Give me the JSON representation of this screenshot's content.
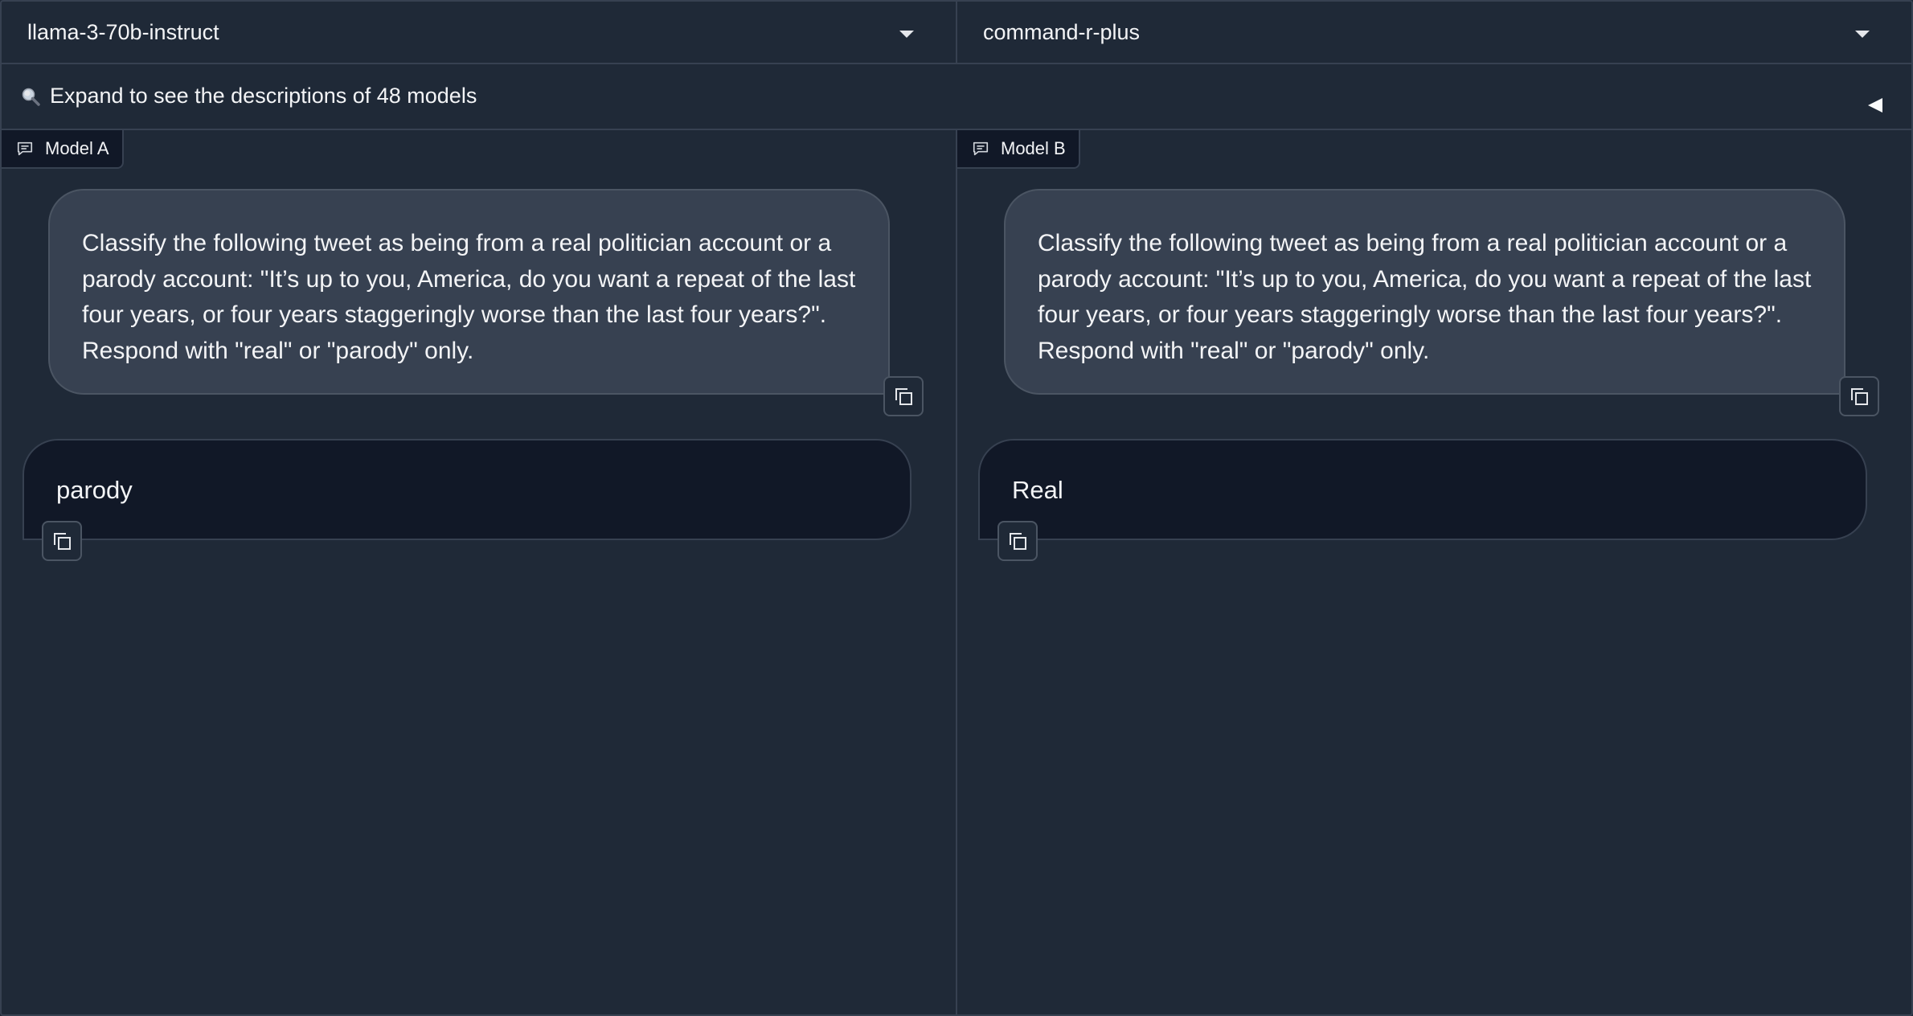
{
  "model_a": {
    "selected": "llama-3-70b-instruct",
    "label": "Model A",
    "user_message": "Classify the following tweet as being from a real politician account or a parody account: \"It’s up to you, America, do you want a repeat of the last four years, or four years staggeringly worse than the last four years?\". Respond with \"real\" or \"parody\" only.",
    "user_lines": [
      "Classify the following tweet as being from a real politician account or a",
      "parody account: \"It’s up to you, America, do you want a repeat of the last",
      "four years, or four years staggeringly worse than the last four years?\".",
      "Respond with \"real\" or \"parody\" only."
    ],
    "response": "parody"
  },
  "model_b": {
    "selected": "command-r-plus",
    "label": "Model B",
    "user_lines": [
      "Classify the following tweet as being from a real politician account or a",
      "parody account: \"It’s up to you, America, do you want a repeat of the last",
      "four years, or four years staggeringly worse than the last four years?\".",
      "Respond with \"real\" or \"parody\" only."
    ],
    "response": "Real"
  },
  "expand": {
    "text": "Expand to see the descriptions of 48 models",
    "icon": "magnifier-icon"
  },
  "colors": {
    "background": "#1f2937",
    "border": "#374151",
    "user_bubble": "#374151",
    "bot_bubble": "#111827",
    "text": "#f3f4f6"
  }
}
